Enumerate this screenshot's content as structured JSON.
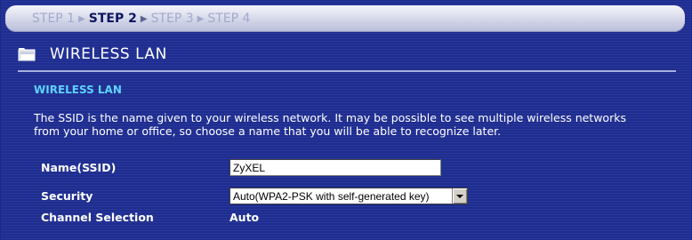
{
  "steps": [
    {
      "label": "STEP 1",
      "active": false
    },
    {
      "label": "STEP 2",
      "active": true
    },
    {
      "label": "STEP 3",
      "active": false
    },
    {
      "label": "STEP 4",
      "active": false
    }
  ],
  "page": {
    "title": "WIRELESS LAN",
    "icon": "folder-icon"
  },
  "section": {
    "title": "WIRELESS LAN",
    "description": "The SSID is the name given to your wireless network. It may be possible to see multiple wireless networks from your home or office, so choose a name that you will be able to recognize later."
  },
  "form": {
    "ssid_label": "Name(SSID)",
    "ssid_value": "ZyXEL",
    "security_label": "Security",
    "security_value": "Auto(WPA2-PSK with self-generated key)",
    "channel_label": "Channel Selection",
    "channel_value": "Auto"
  },
  "colors": {
    "background": "#24339a",
    "section_title": "#5fd2ff",
    "active_step": "#0d1560",
    "inactive_step": "#a3a9cc"
  }
}
